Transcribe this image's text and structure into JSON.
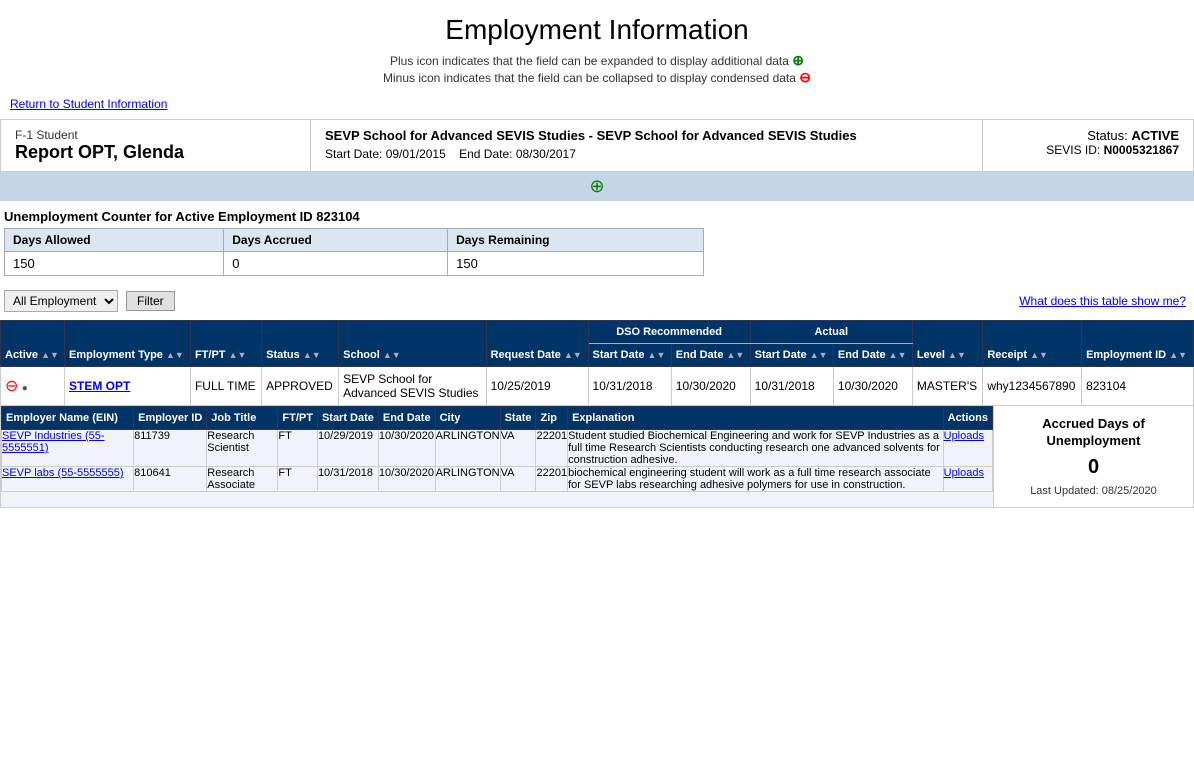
{
  "page": {
    "title": "Employment Information",
    "plus_hint": "Plus icon indicates that the field can be expanded to display additional data",
    "minus_hint": "Minus icon indicates that the field can be collapsed to display condensed data",
    "return_link": "Return to Student Information"
  },
  "student": {
    "type": "F-1 Student",
    "name": "Report OPT, Glenda",
    "school_name": "SEVP School for Advanced SEVIS Studies - SEVP School for Advanced SEVIS Studies",
    "start_date": "09/01/2015",
    "end_date": "08/30/2017",
    "status_label": "Status:",
    "status_value": "ACTIVE",
    "sevis_label": "SEVIS ID:",
    "sevis_value": "N0005321867"
  },
  "unemployment": {
    "title": "Unemployment Counter for Active Employment ID 823104",
    "headers": [
      "Days Allowed",
      "Days Accrued",
      "Days Remaining"
    ],
    "values": [
      "150",
      "0",
      "150"
    ]
  },
  "filter": {
    "options": [
      "All Employment"
    ],
    "selected": "All Employment",
    "button_label": "Filter",
    "what_link": "What does this table show me?"
  },
  "table": {
    "headers": {
      "active": "Active",
      "employment_type": "Employment Type",
      "ftpt": "FT/PT",
      "status": "Status",
      "school": "School",
      "request_date": "Request Date",
      "dso_recommended": "DSO Recommended",
      "dso_start": "Start Date",
      "dso_end": "End Date",
      "actual": "Actual",
      "act_start": "Start Date",
      "act_end": "End Date",
      "level": "Level",
      "receipt": "Receipt",
      "employment_id": "Employment ID"
    },
    "rows": [
      {
        "active_icon": "●",
        "employment_type": "STEM OPT",
        "ftpt": "FULL TIME",
        "status": "APPROVED",
        "school": "SEVP School for Advanced SEVIS Studies",
        "request_date": "10/25/2019",
        "dso_start": "10/31/2018",
        "dso_end": "10/30/2020",
        "act_start": "10/31/2018",
        "act_end": "10/30/2020",
        "level": "MASTER'S",
        "receipt": "why1234567890",
        "employment_id": "823104",
        "employers": [
          {
            "name": "SEVP Industries (55-5555551)",
            "ein": "811739",
            "job_title": "Research Scientist",
            "ftpt": "FT",
            "start_date": "10/29/2019",
            "end_date": "10/30/2020",
            "city": "ARLINGTON",
            "state": "VA",
            "zip": "22201",
            "explanation": "Student studied Biochemical Engineering and work for SEVP Industries as a full time Research Scientists conducting research one advanced solvents for construction adhesive.",
            "actions": "Uploads"
          },
          {
            "name": "SEVP labs (55-5555555)",
            "ein": "810641",
            "job_title": "Research Associate",
            "ftpt": "FT",
            "start_date": "10/31/2018",
            "end_date": "10/30/2020",
            "city": "ARLINGTON",
            "state": "VA",
            "zip": "22201",
            "explanation": "biochemical engineering student will work as a full time research associate for SEVP labs researching adhesive polymers for use in construction.",
            "actions": "Uploads"
          }
        ],
        "accrued": {
          "title": "Accrued Days of Unemployment",
          "value": "0",
          "last_updated_label": "Last Updated:",
          "last_updated": "08/25/2020"
        }
      }
    ]
  }
}
